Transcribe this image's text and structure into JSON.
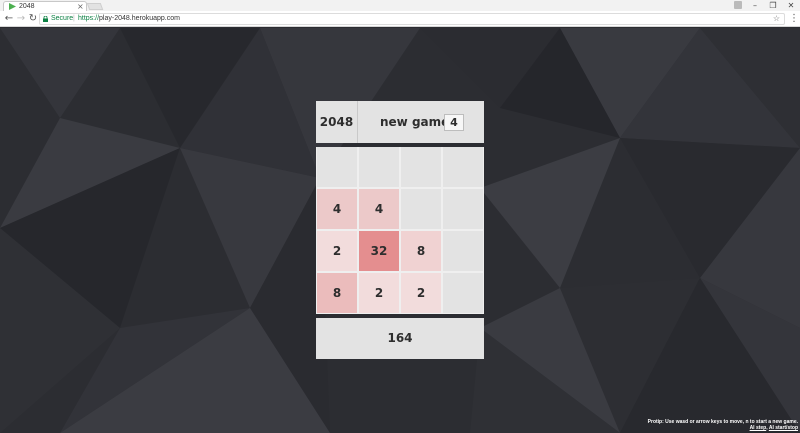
{
  "browser": {
    "tab_title": "2048",
    "tab_close": "×",
    "secure_label": "Secure",
    "url_scheme": "https://",
    "url_rest": "play-2048.herokuapp.com",
    "window_min": "–",
    "window_max": "❐",
    "window_close": "✕"
  },
  "header": {
    "logo": "2048",
    "new_game_label": "new game",
    "size_value": "4"
  },
  "board": {
    "rows": [
      [
        "",
        "",
        "",
        ""
      ],
      [
        "4",
        "4",
        "",
        ""
      ],
      [
        "2",
        "32",
        "8",
        ""
      ],
      [
        "8",
        "2",
        "2",
        ""
      ]
    ]
  },
  "score": "164",
  "footer": {
    "protip": "Protip: Use wasd or arrow keys to move, n to start a new game.",
    "link_ai_step": "AI step",
    "link_sep": ", ",
    "link_ai_start_stop": "AI start/stop"
  },
  "colors": {
    "accent_secure": "#0b8043",
    "tile_2": "#f2dcdc",
    "tile_4": "#ecc9c9",
    "tile_8": "#f0d2d2",
    "tile_32": "#e48e8f"
  }
}
